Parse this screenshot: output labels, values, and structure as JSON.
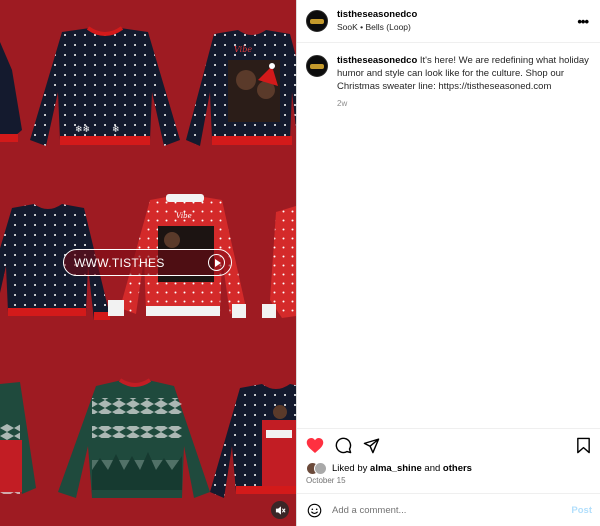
{
  "media": {
    "cta_text": "WWW.TISTHES",
    "icons": {
      "play": "play-icon",
      "mute": "speaker-muted-icon"
    },
    "colors": {
      "background": "#9e1b22",
      "navy_sweater": "#141a2e",
      "red_sweater": "#d42a2a",
      "green_sweater": "#1f4a3d",
      "trim_red": "#d31a1a"
    }
  },
  "header": {
    "username": "tistheseasonedco",
    "audio": "SooK • Bells (Loop)",
    "more_icon": "more-horizontal-icon",
    "more_label": "•••"
  },
  "post": {
    "username": "tistheseasonedco",
    "caption": "It's here! We are redefining what holiday humor and style can look like for the culture. Shop our Christmas sweater line: https://tistheseasoned.com",
    "time_ago": "2w"
  },
  "actions": {
    "like_icon": "heart-filled-icon",
    "comment_icon": "comment-icon",
    "share_icon": "share-icon",
    "save_icon": "bookmark-icon",
    "like_color": "#ff3040"
  },
  "likes": {
    "prefix": "Liked by",
    "user": "alma_shine",
    "conj": "and",
    "others": "others"
  },
  "date": "October 15",
  "comment": {
    "placeholder": "Add a comment...",
    "post_label": "Post",
    "emoji_icon": "emoji-icon"
  }
}
